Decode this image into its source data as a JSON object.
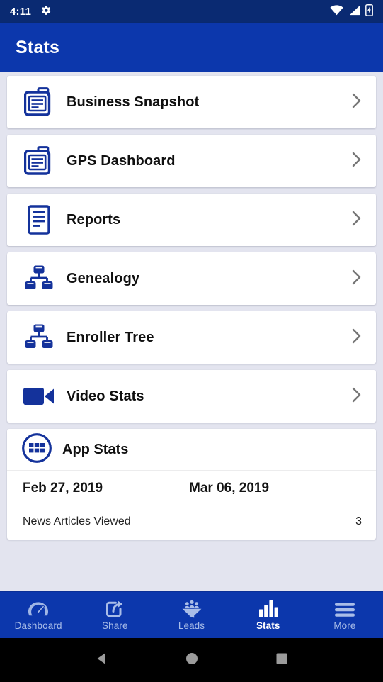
{
  "status_bar": {
    "time": "4:11",
    "icons": [
      "gear-icon",
      "wifi-icon",
      "cellular-signal-icon",
      "battery-charging-icon"
    ]
  },
  "app_bar": {
    "title": "Stats"
  },
  "menu_items": [
    {
      "label": "Business Snapshot",
      "icon": "clipboard-icon",
      "chevron": "›"
    },
    {
      "label": "GPS Dashboard",
      "icon": "clipboard-icon",
      "chevron": "›"
    },
    {
      "label": "Reports",
      "icon": "document-icon",
      "chevron": "›"
    },
    {
      "label": "Genealogy",
      "icon": "org-tree-icon",
      "chevron": "›"
    },
    {
      "label": "Enroller Tree",
      "icon": "org-tree-icon",
      "chevron": "›"
    },
    {
      "label": "Video Stats",
      "icon": "video-camera-icon",
      "chevron": "›"
    }
  ],
  "app_stats": {
    "label": "App Stats",
    "icon": "app-grid-circle-icon",
    "date_start": "Feb 27, 2019",
    "date_end": "Mar 06, 2019",
    "rows": [
      {
        "label": "News Articles Viewed",
        "value": "3"
      }
    ]
  },
  "bottom_nav": {
    "items": [
      {
        "label": "Dashboard",
        "icon": "speedometer-icon",
        "active": false
      },
      {
        "label": "Share",
        "icon": "share-icon",
        "active": false
      },
      {
        "label": "Leads",
        "icon": "lead-funnel-icon",
        "active": false
      },
      {
        "label": "Stats",
        "icon": "bar-chart-icon",
        "active": true
      },
      {
        "label": "More",
        "icon": "hamburger-icon",
        "active": false
      }
    ]
  },
  "system_nav": {
    "back": "back-triangle-icon",
    "home": "home-circle-icon",
    "recents": "recents-square-icon"
  },
  "colors": {
    "status_bar": "#0a2a72",
    "app_bar": "#0c37ac",
    "page_bg": "#e3e4ef",
    "card_bg": "#ffffff",
    "icon_blue": "#14329b",
    "nav_inactive": "#a9bde8",
    "nav_active": "#ffffff",
    "chevron_gray": "#767676"
  }
}
